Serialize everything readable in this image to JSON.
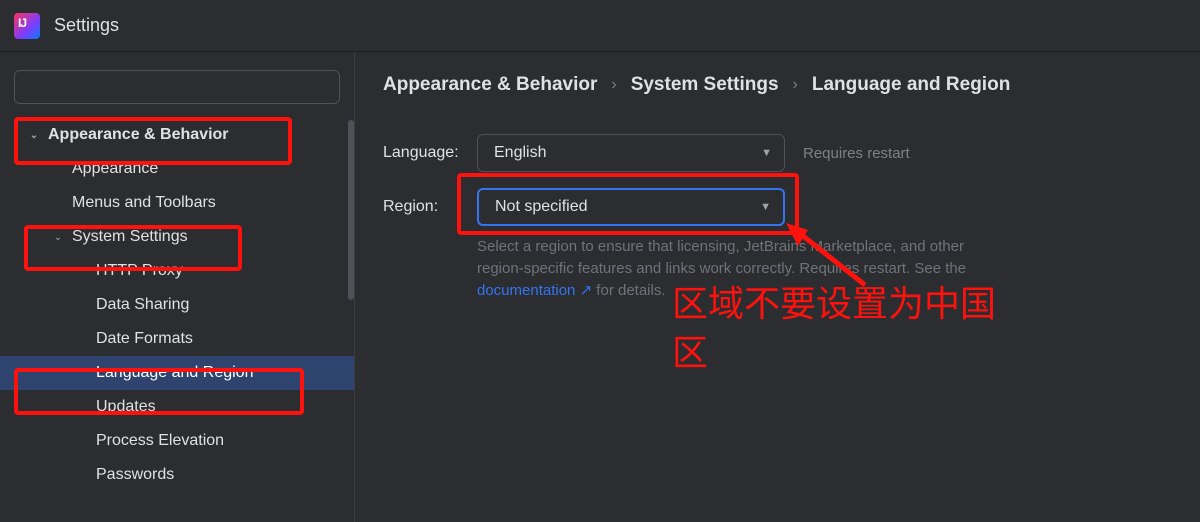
{
  "titlebar": {
    "app_glyph": "IJ",
    "title": "Settings"
  },
  "sidebar": {
    "search_placeholder": "",
    "items": [
      {
        "label": "Appearance & Behavior",
        "level": 1,
        "expanded": true
      },
      {
        "label": "Appearance",
        "level": 2
      },
      {
        "label": "Menus and Toolbars",
        "level": 2
      },
      {
        "label": "System Settings",
        "level": 2,
        "expanded": true,
        "has_children": true
      },
      {
        "label": "HTTP Proxy",
        "level": 3
      },
      {
        "label": "Data Sharing",
        "level": 3
      },
      {
        "label": "Date Formats",
        "level": 3
      },
      {
        "label": "Language and Region",
        "level": 3,
        "selected": true
      },
      {
        "label": "Updates",
        "level": 3
      },
      {
        "label": "Process Elevation",
        "level": 3
      },
      {
        "label": "Passwords",
        "level": 3
      }
    ]
  },
  "breadcrumbs": {
    "parts": [
      "Appearance & Behavior",
      "System Settings",
      "Language and Region"
    ],
    "sep": "›"
  },
  "form": {
    "language_label": "Language:",
    "language_value": "English",
    "language_hint": "Requires restart",
    "region_label": "Region:",
    "region_value": "Not specified",
    "help_prefix": "Select a region to ensure that licensing, JetBrains Marketplace, and other region-specific features and links work correctly. Requires restart. See the ",
    "help_link": "documentation ↗",
    "help_suffix": " for details."
  },
  "annotations": {
    "warning_line1": "区域不要设置为中国",
    "warning_line2": "区"
  }
}
